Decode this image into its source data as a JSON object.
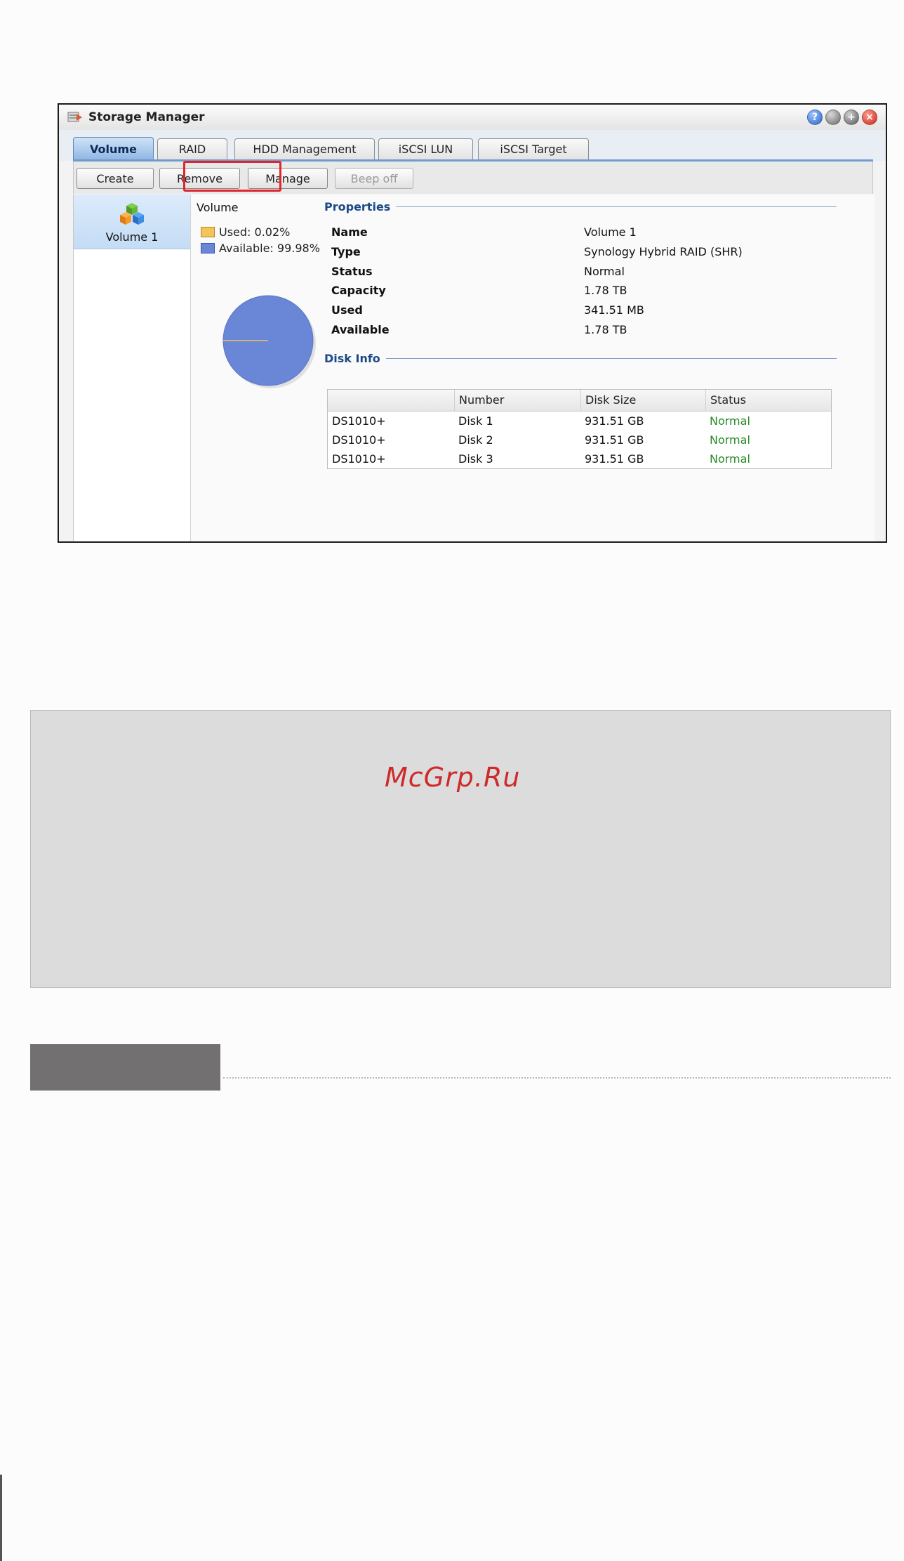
{
  "window": {
    "title": "Storage Manager",
    "controls": [
      "?",
      "",
      "+",
      "×"
    ]
  },
  "tabs": [
    {
      "label": "Volume",
      "active": true
    },
    {
      "label": "RAID",
      "active": false
    },
    {
      "label": "HDD Management",
      "active": false
    },
    {
      "label": "iSCSI LUN",
      "active": false
    },
    {
      "label": "iSCSI Target",
      "active": false
    }
  ],
  "toolbar": {
    "create": "Create",
    "remove": "Remove",
    "manage": "Manage",
    "beep_off": "Beep off"
  },
  "sidebar": {
    "items": [
      {
        "label": "Volume 1",
        "icon": "volume-cubes-icon"
      }
    ]
  },
  "usage": {
    "title": "Volume",
    "used_label": "Used: 0.02%",
    "available_label": "Available: 99.98%",
    "used_pct": 0.02,
    "available_pct": 99.98,
    "used_color": "#f2c45a",
    "available_color": "#6a86d6"
  },
  "properties": {
    "heading": "Properties",
    "rows": [
      {
        "key": "Name",
        "value": "Volume 1"
      },
      {
        "key": "Type",
        "value": "Synology Hybrid RAID (SHR)"
      },
      {
        "key": "Status",
        "value": "Normal"
      },
      {
        "key": "Capacity",
        "value": "1.78 TB"
      },
      {
        "key": "Used",
        "value": "341.51 MB"
      },
      {
        "key": "Available",
        "value": "1.78 TB"
      }
    ]
  },
  "disk_info": {
    "heading": "Disk Info",
    "columns": [
      "",
      "Number",
      "Disk Size",
      "Status"
    ],
    "rows": [
      [
        "DS1010+",
        "Disk 1",
        "931.51 GB",
        "Normal"
      ],
      [
        "DS1010+",
        "Disk 2",
        "931.51 GB",
        "Normal"
      ],
      [
        "DS1010+",
        "Disk 3",
        "931.51 GB",
        "Normal"
      ]
    ]
  },
  "watermark": "McGrp.Ru"
}
